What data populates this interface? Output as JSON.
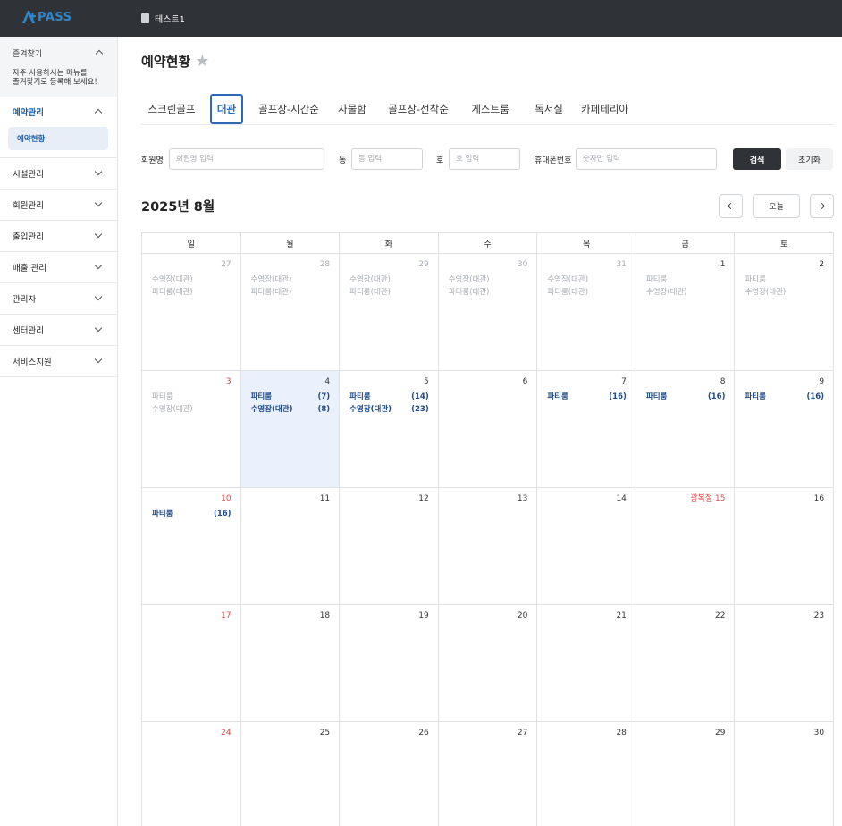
{
  "app": {
    "logo_text": "PASS",
    "breadcrumb": "테스트1"
  },
  "sidebar": {
    "favorites": {
      "title": "즐겨찾기",
      "desc_line1": "자주 사용하시는 메뉴를",
      "desc_line2": "즐겨찾기로 등록해 보세요!"
    },
    "menu": [
      {
        "label": "예약관리",
        "expanded": true,
        "sub": [
          "예약현황"
        ]
      },
      {
        "label": "시설관리"
      },
      {
        "label": "회원관리"
      },
      {
        "label": "출입관리"
      },
      {
        "label": "매출 관리"
      },
      {
        "label": "관리자"
      },
      {
        "label": "센터관리"
      },
      {
        "label": "서비스지원"
      }
    ]
  },
  "page": {
    "title": "예약현황"
  },
  "tabs": [
    "스크린골프",
    "대관",
    "골프장-시간순",
    "사물함",
    "골프장-선착순",
    "게스트룸",
    "독서실",
    "카페테리아"
  ],
  "active_tab": "대관",
  "filters": {
    "member_label": "회원명",
    "member_placeholder": "회원명 입력",
    "dong_label": "동",
    "dong_placeholder": "동 입력",
    "ho_label": "호",
    "ho_placeholder": "호 입력",
    "phone_label": "휴대폰번호",
    "phone_placeholder": "숫자만 입력",
    "search_label": "검색",
    "reset_label": "초기화"
  },
  "calendar": {
    "month_title": "2025년 8월",
    "today_label": "오늘",
    "weekdays": [
      "일",
      "월",
      "화",
      "수",
      "목",
      "금",
      "토"
    ],
    "weeks": [
      [
        {
          "day": "27",
          "other": true,
          "events": [
            {
              "name": "수영장(대관)"
            },
            {
              "name": "파티룸(대관)"
            }
          ]
        },
        {
          "day": "28",
          "other": true,
          "events": [
            {
              "name": "수영장(대관)"
            },
            {
              "name": "파티룸(대관)"
            }
          ]
        },
        {
          "day": "29",
          "other": true,
          "events": [
            {
              "name": "수영장(대관)"
            },
            {
              "name": "파티룸(대관)"
            }
          ]
        },
        {
          "day": "30",
          "other": true,
          "events": [
            {
              "name": "수영장(대관)"
            },
            {
              "name": "파티룸(대관)"
            }
          ]
        },
        {
          "day": "31",
          "other": true,
          "events": [
            {
              "name": "수영장(대관)"
            },
            {
              "name": "파티룸(대관)"
            }
          ]
        },
        {
          "day": "1",
          "muted_events": true,
          "events": [
            {
              "name": "파티룸"
            },
            {
              "name": "수영장(대관)"
            }
          ]
        },
        {
          "day": "2",
          "muted_events": true,
          "events": [
            {
              "name": "파티룸"
            },
            {
              "name": "수영장(대관)"
            }
          ]
        }
      ],
      [
        {
          "day": "3",
          "red": true,
          "muted_events": true,
          "events": [
            {
              "name": "파티룸"
            },
            {
              "name": "수영장(대관)"
            }
          ]
        },
        {
          "day": "4",
          "today": true,
          "events": [
            {
              "name": "파티룸",
              "count": "(7)"
            },
            {
              "name": "수영장(대관)",
              "count": "(8)"
            }
          ]
        },
        {
          "day": "5",
          "events": [
            {
              "name": "파티룸",
              "count": "(14)"
            },
            {
              "name": "수영장(대관)",
              "count": "(23)"
            }
          ]
        },
        {
          "day": "6",
          "events": []
        },
        {
          "day": "7",
          "events": [
            {
              "name": "파티룸",
              "count": "(16)"
            }
          ]
        },
        {
          "day": "8",
          "events": [
            {
              "name": "파티룸",
              "count": "(16)"
            }
          ]
        },
        {
          "day": "9",
          "events": [
            {
              "name": "파티룸",
              "count": "(16)"
            }
          ]
        }
      ],
      [
        {
          "day": "10",
          "red": true,
          "events": [
            {
              "name": "파티룸",
              "count": "(16)"
            }
          ]
        },
        {
          "day": "11",
          "events": []
        },
        {
          "day": "12",
          "events": []
        },
        {
          "day": "13",
          "events": []
        },
        {
          "day": "14",
          "events": []
        },
        {
          "day": "광복절 15",
          "red": true,
          "events": []
        },
        {
          "day": "16",
          "events": []
        }
      ],
      [
        {
          "day": "17",
          "red": true,
          "events": []
        },
        {
          "day": "18",
          "events": []
        },
        {
          "day": "19",
          "events": []
        },
        {
          "day": "20",
          "events": []
        },
        {
          "day": "21",
          "events": []
        },
        {
          "day": "22",
          "events": []
        },
        {
          "day": "23",
          "events": []
        }
      ],
      [
        {
          "day": "24",
          "red": true,
          "events": []
        },
        {
          "day": "25",
          "events": []
        },
        {
          "day": "26",
          "events": []
        },
        {
          "day": "27",
          "events": []
        },
        {
          "day": "28",
          "events": []
        },
        {
          "day": "29",
          "events": []
        },
        {
          "day": "30",
          "events": []
        }
      ]
    ]
  },
  "colors": {
    "topbar": "#2f3338",
    "accent": "#2a6ab8",
    "weekend_red": "#e04a4a",
    "today_bg": "#eaf1fc"
  }
}
